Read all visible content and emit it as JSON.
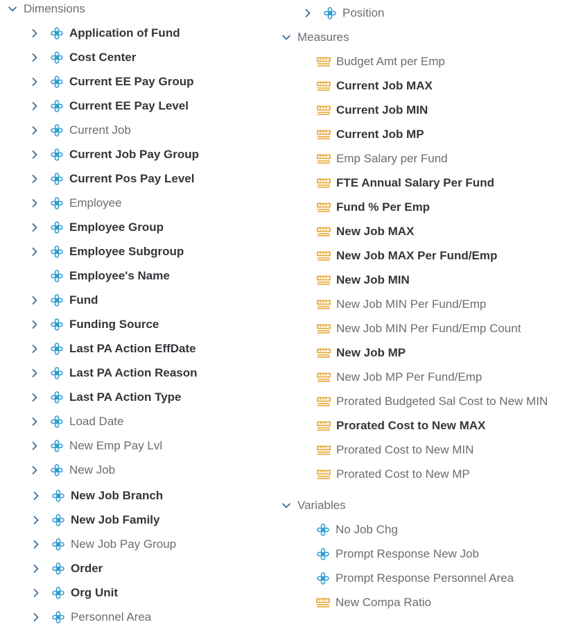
{
  "left": {
    "section_label": "Dimensions",
    "items": [
      {
        "label": "Application of Fund",
        "bold": true,
        "expandable": true,
        "icon": "dimension-icon"
      },
      {
        "label": "Cost Center",
        "bold": true,
        "expandable": true,
        "icon": "dimension-icon"
      },
      {
        "label": "Current EE Pay Group",
        "bold": true,
        "expandable": true,
        "icon": "dimension-icon"
      },
      {
        "label": "Current EE Pay Level",
        "bold": true,
        "expandable": true,
        "icon": "dimension-icon"
      },
      {
        "label": "Current Job",
        "bold": false,
        "expandable": true,
        "icon": "dimension-icon"
      },
      {
        "label": "Current Job Pay Group",
        "bold": true,
        "expandable": true,
        "icon": "dimension-icon"
      },
      {
        "label": "Current Pos Pay Level",
        "bold": true,
        "expandable": true,
        "icon": "dimension-icon"
      },
      {
        "label": "Employee",
        "bold": false,
        "expandable": true,
        "icon": "dimension-icon"
      },
      {
        "label": "Employee Group",
        "bold": true,
        "expandable": true,
        "icon": "dimension-icon"
      },
      {
        "label": "Employee Subgroup",
        "bold": true,
        "expandable": true,
        "icon": "dimension-icon"
      },
      {
        "label": "Employee's Name",
        "bold": true,
        "expandable": false,
        "icon": "dimension-icon"
      },
      {
        "label": "Fund",
        "bold": true,
        "expandable": true,
        "icon": "dimension-icon"
      },
      {
        "label": "Funding Source",
        "bold": true,
        "expandable": true,
        "icon": "dimension-icon"
      },
      {
        "label": "Last PA Action EffDate",
        "bold": true,
        "expandable": true,
        "icon": "dimension-icon"
      },
      {
        "label": "Last PA Action Reason",
        "bold": true,
        "expandable": true,
        "icon": "dimension-icon"
      },
      {
        "label": "Last PA Action Type",
        "bold": true,
        "expandable": true,
        "icon": "dimension-icon"
      },
      {
        "label": "Load Date",
        "bold": false,
        "expandable": true,
        "icon": "dimension-icon"
      },
      {
        "label": "New Emp Pay Lvl",
        "bold": false,
        "expandable": true,
        "icon": "dimension-icon"
      },
      {
        "label": "New Job",
        "bold": false,
        "expandable": true,
        "icon": "dimension-icon"
      },
      {
        "label": "New Job Branch",
        "bold": true,
        "expandable": true,
        "icon": "dimension-icon"
      },
      {
        "label": "New Job Family",
        "bold": true,
        "expandable": true,
        "icon": "dimension-icon"
      },
      {
        "label": "New Job Pay Group",
        "bold": false,
        "expandable": true,
        "icon": "dimension-icon"
      },
      {
        "label": "Order",
        "bold": true,
        "expandable": true,
        "icon": "dimension-icon"
      },
      {
        "label": "Org Unit",
        "bold": true,
        "expandable": true,
        "icon": "dimension-icon"
      },
      {
        "label": "Personnel Area",
        "bold": false,
        "expandable": true,
        "icon": "dimension-icon"
      }
    ]
  },
  "right": {
    "position_item": {
      "label": "Position",
      "bold": false,
      "expandable": true,
      "icon": "dimension-icon"
    },
    "measures_label": "Measures",
    "measures": [
      {
        "label": "Budget Amt per Emp",
        "bold": false,
        "icon": "measure-icon"
      },
      {
        "label": "Current Job MAX",
        "bold": true,
        "icon": "measure-icon"
      },
      {
        "label": "Current Job MIN",
        "bold": true,
        "icon": "measure-icon"
      },
      {
        "label": "Current Job MP",
        "bold": true,
        "icon": "measure-icon"
      },
      {
        "label": "Emp Salary per Fund",
        "bold": false,
        "icon": "measure-icon"
      },
      {
        "label": "FTE Annual Salary Per Fund",
        "bold": true,
        "icon": "measure-icon"
      },
      {
        "label": "Fund % Per Emp",
        "bold": true,
        "icon": "measure-icon"
      },
      {
        "label": "New Job MAX",
        "bold": true,
        "icon": "measure-icon"
      },
      {
        "label": "New Job MAX Per Fund/Emp",
        "bold": true,
        "icon": "measure-icon"
      },
      {
        "label": "New Job MIN",
        "bold": true,
        "icon": "measure-icon"
      },
      {
        "label": "New Job MIN Per Fund/Emp",
        "bold": false,
        "icon": "measure-icon"
      },
      {
        "label": "New Job MIN Per Fund/Emp Count",
        "bold": false,
        "icon": "measure-icon"
      },
      {
        "label": "New Job MP",
        "bold": true,
        "icon": "measure-icon"
      },
      {
        "label": "New Job MP Per Fund/Emp",
        "bold": false,
        "icon": "measure-icon"
      },
      {
        "label": "Prorated Budgeted Sal Cost to New MIN",
        "bold": false,
        "icon": "measure-icon"
      },
      {
        "label": "Prorated Cost to New MAX",
        "bold": true,
        "icon": "measure-icon"
      },
      {
        "label": "Prorated Cost to New MIN",
        "bold": false,
        "icon": "measure-icon"
      },
      {
        "label": "Prorated Cost to New MP",
        "bold": false,
        "icon": "measure-icon"
      }
    ],
    "variables_label": "Variables",
    "variables": [
      {
        "label": "No Job Chg",
        "bold": false,
        "icon": "dimension-icon"
      },
      {
        "label": "Prompt Response New Job",
        "bold": false,
        "icon": "dimension-icon"
      },
      {
        "label": "Prompt Response Personnel Area",
        "bold": false,
        "icon": "dimension-icon"
      },
      {
        "label": "New Compa Ratio",
        "bold": false,
        "icon": "measure-icon"
      }
    ]
  },
  "colors": {
    "dimension_icon": "#2b9ad0",
    "measure_icon": "#e8a125",
    "chevron": "#3a6d99",
    "text_bold": "#32363a",
    "text_regular": "#6a6d70"
  }
}
